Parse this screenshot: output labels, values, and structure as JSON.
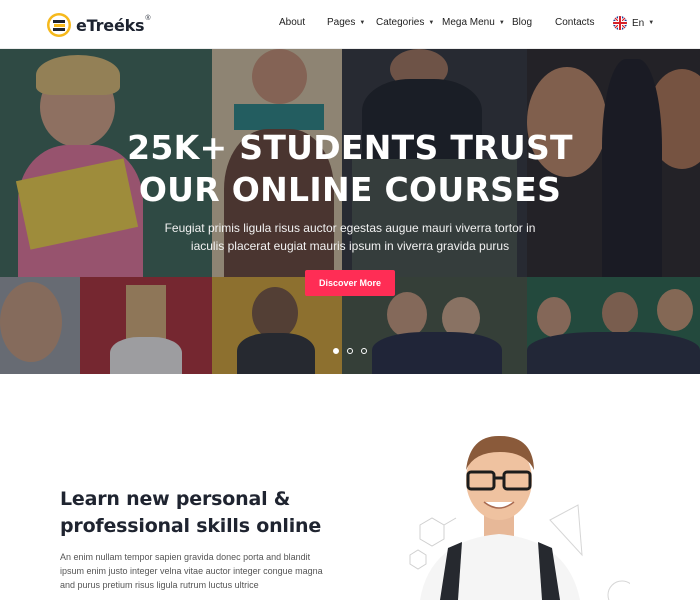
{
  "header": {
    "logo_text": "eTreéks",
    "logo_reg": "®",
    "nav": {
      "about": "About",
      "pages": "Pages",
      "categories": "Categories",
      "mega_menu": "Mega Menu",
      "blog": "Blog",
      "contacts": "Contacts",
      "language": "En"
    }
  },
  "hero": {
    "title_line1": "25K+ STUDENTS TRUST",
    "title_line2": "OUR ONLINE COURSES",
    "subtitle_line1": "Feugiat primis ligula risus auctor egestas augue mauri viverra tortor in",
    "subtitle_line2": "iaculis placerat eugiat mauris ipsum in viverra gravida purus",
    "button_label": "Discover More",
    "slide_count": 3,
    "active_slide": 1
  },
  "section": {
    "title_line1": "Learn new personal &",
    "title_line2": "professional skills online",
    "desc_line1": "An enim nullam tempor sapien gravida donec porta and blandit",
    "desc_line2": "ipsum enim justo integer velna vitae auctor integer congue magna",
    "desc_line3": "and purus pretium risus ligula rutrum luctus ultrice"
  },
  "colors": {
    "accent": "#ff2d55",
    "heading": "#1f2430",
    "logo_yellow": "#f6b91c"
  }
}
